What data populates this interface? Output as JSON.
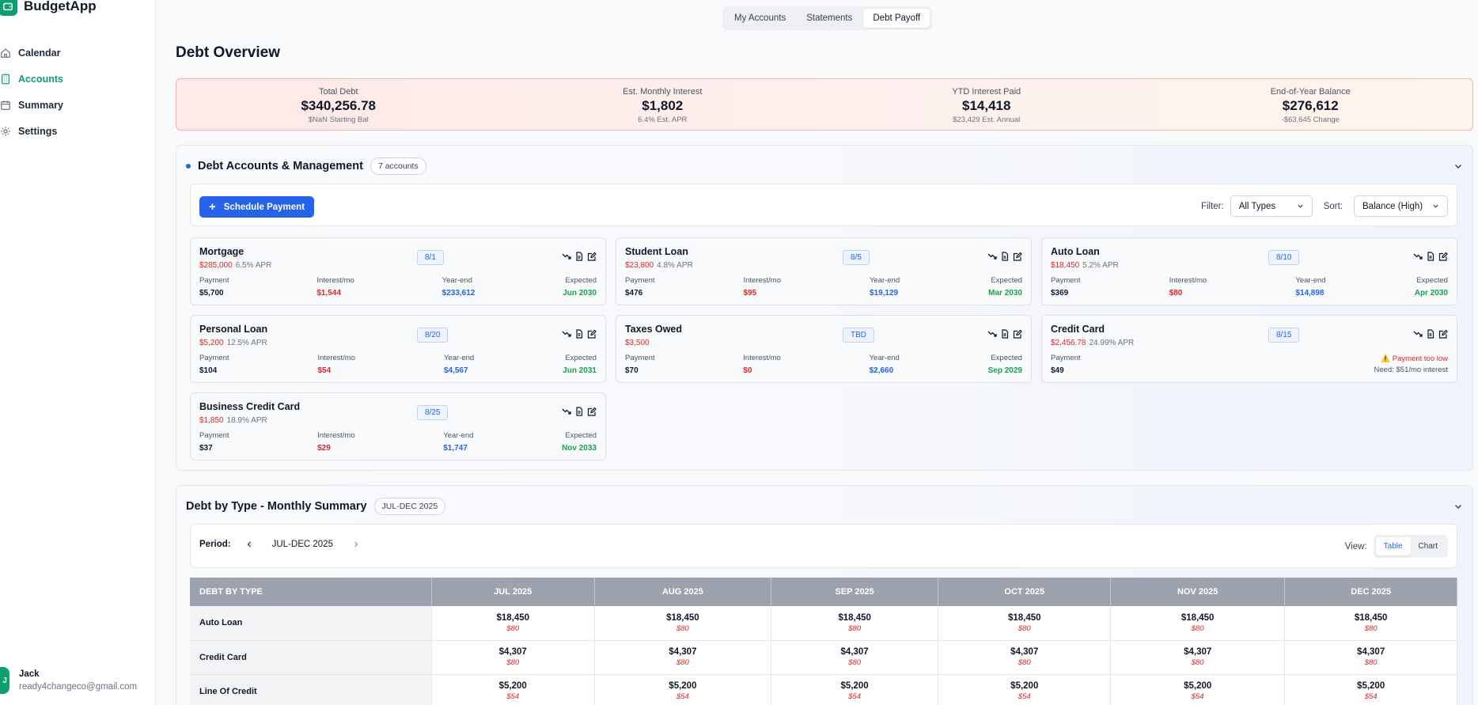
{
  "app": {
    "name": "BudgetApp",
    "accent": "#0f9f6e"
  },
  "sidebar": {
    "items": [
      {
        "label": "Calendar",
        "icon": "home-icon"
      },
      {
        "label": "Accounts",
        "icon": "building-icon",
        "active": true
      },
      {
        "label": "Summary",
        "icon": "calendar-icon"
      },
      {
        "label": "Settings",
        "icon": "gear-icon"
      }
    ],
    "user": {
      "initial": "J",
      "name": "Jack",
      "email": "ready4changeco@gmail.com"
    }
  },
  "tabs": [
    {
      "label": "My Accounts"
    },
    {
      "label": "Statements"
    },
    {
      "label": "Debt Payoff",
      "active": true
    }
  ],
  "page_title": "Debt Overview",
  "overview": [
    {
      "label": "Total Debt",
      "value": "$340,256.78",
      "sub": "$NaN Starting Bal"
    },
    {
      "label": "Est. Monthly Interest",
      "value": "$1,802",
      "sub": "6.4% Est. APR"
    },
    {
      "label": "YTD Interest Paid",
      "value": "$14,418",
      "sub": "$23,429 Est. Annual"
    },
    {
      "label": "End-of-Year Balance",
      "value": "$276,612",
      "sub": "-$63,645 Change"
    }
  ],
  "debt_section": {
    "title": "Debt Accounts & Management",
    "count": "7 accounts",
    "schedule_button": "Schedule Payment",
    "filter_label": "Filter:",
    "filter_value": "All Types",
    "sort_label": "Sort:",
    "sort_value": "Balance (High)",
    "metric_labels": {
      "payment": "Payment",
      "interest": "Interest/mo",
      "yearend": "Year-end",
      "expected": "Expected"
    },
    "cards": [
      {
        "name": "Mortgage",
        "balance": "$285,000",
        "apr": "6.5% APR",
        "date": "8/1",
        "payment": "$5,700",
        "interest": "$1,544",
        "yearend": "$233,612",
        "expected": "Jun 2030"
      },
      {
        "name": "Student Loan",
        "balance": "$23,800",
        "apr": "4.8% APR",
        "date": "8/5",
        "payment": "$476",
        "interest": "$95",
        "yearend": "$19,129",
        "expected": "Mar 2030"
      },
      {
        "name": "Auto Loan",
        "balance": "$18,450",
        "apr": "5.2% APR",
        "date": "8/10",
        "payment": "$369",
        "interest": "$80",
        "yearend": "$14,898",
        "expected": "Apr 2030"
      },
      {
        "name": "Personal Loan",
        "balance": "$5,200",
        "apr": "12.5% APR",
        "date": "8/20",
        "payment": "$104",
        "interest": "$54",
        "yearend": "$4,567",
        "expected": "Jun 2031"
      },
      {
        "name": "Taxes Owed",
        "balance": "$3,500",
        "apr": "",
        "date": "TBD",
        "payment": "$70",
        "interest": "$0",
        "yearend": "$2,660",
        "expected": "Sep 2029"
      },
      {
        "name": "Credit Card",
        "balance": "$2,456.78",
        "apr": "24.99% APR",
        "date": "8/15",
        "payment": "$49",
        "warning": "⚠️ Payment too low",
        "warning_sub": "Need: $51/mo interest"
      },
      {
        "name": "Business Credit Card",
        "balance": "$1,850",
        "apr": "18.9% APR",
        "date": "8/25",
        "payment": "$37",
        "interest": "$29",
        "yearend": "$1,747",
        "expected": "Nov 2033"
      }
    ]
  },
  "summary_section": {
    "title": "Debt by Type - Monthly Summary",
    "badge": "JUL-DEC 2025",
    "period_label": "Period:",
    "period_value": "JUL-DEC 2025",
    "view_label": "View:",
    "view_options": [
      "Table",
      "Chart"
    ],
    "table": {
      "headers": [
        "DEBT BY TYPE",
        "JUL 2025",
        "AUG 2025",
        "SEP 2025",
        "OCT 2025",
        "NOV 2025",
        "DEC 2025"
      ],
      "rows": [
        {
          "label": "Auto Loan",
          "cells": [
            [
              "$18,450",
              "$80"
            ],
            [
              "$18,450",
              "$80"
            ],
            [
              "$18,450",
              "$80"
            ],
            [
              "$18,450",
              "$80"
            ],
            [
              "$18,450",
              "$80"
            ],
            [
              "$18,450",
              "$80"
            ]
          ]
        },
        {
          "label": "Credit Card",
          "cells": [
            [
              "$4,307",
              "$80"
            ],
            [
              "$4,307",
              "$80"
            ],
            [
              "$4,307",
              "$80"
            ],
            [
              "$4,307",
              "$80"
            ],
            [
              "$4,307",
              "$80"
            ],
            [
              "$4,307",
              "$80"
            ]
          ]
        },
        {
          "label": "Line Of Credit",
          "cells": [
            [
              "$5,200",
              "$54"
            ],
            [
              "$5,200",
              "$54"
            ],
            [
              "$5,200",
              "$54"
            ],
            [
              "$5,200",
              "$54"
            ],
            [
              "$5,200",
              "$54"
            ],
            [
              "$5,200",
              "$54"
            ]
          ]
        }
      ]
    }
  }
}
